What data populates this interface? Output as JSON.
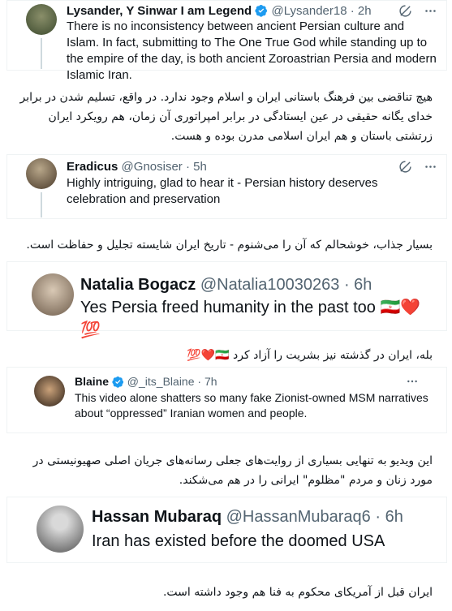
{
  "tweets": [
    {
      "name": "Lysander, Y Sinwar I am Legend",
      "handle": "@Lysander18",
      "time": "· 2h",
      "verified": true,
      "text": "There is no inconsistency between ancient Persian culture and Islam. In fact, submitting to The One True God while standing up to the empire of the day, is both ancient Zoroastrian Persia and modern Islamic Iran.",
      "translation": "هیچ تناقضی بین فرهنگ باستانی ایران و اسلام وجود ندارد. در واقع، تسلیم شدن در برابر خدای یگانه حقیقی در عین ایستادگی در برابر امپراتوری آن زمان، هم رویکرد ایران زرتشتی باستان و هم ایران اسلامی مدرن بوده و هست."
    },
    {
      "name": "Eradicus",
      "handle": "@Gnosiser",
      "time": "· 5h",
      "verified": false,
      "text": "Highly intriguing, glad to hear it - Persian history deserves celebration and preservation",
      "translation": "بسیار جذاب، خوشحالم که آن را می‌شنوم - تاریخ ایران شایسته تجلیل و حفاظت است."
    },
    {
      "name": "Natalia Bogacz",
      "handle": "@Natalia10030263",
      "time": "· 6h",
      "verified": false,
      "text": "Yes Persia freed humanity in the past too 🇮🇷❤️💯",
      "translation": "بله، ایران در گذشته نیز بشریت را آزاد کرد 🇮🇷❤️💯"
    },
    {
      "name": "Blaine",
      "handle": "@_its_Blaine",
      "time": "· 7h",
      "verified": true,
      "text": "This video alone shatters so many fake Zionist-owned MSM narratives about “oppressed” Iranian women and people.",
      "translation": "این ویدیو به تنهایی بسیاری از روایت‌های جعلی رسانه‌های جریان اصلی صهیونیستی در مورد زنان و مردم \"مظلوم\" ایرانی را در هم می‌شکند."
    },
    {
      "name": "Hassan Mubaraq",
      "handle": "@HassanMubaraq6",
      "time": "· 6h",
      "verified": false,
      "text": "Iran has existed before the doomed USA",
      "translation": "ایران قبل از آمریکای محکوم به فنا هم وجود داشته است."
    }
  ],
  "colors": {
    "verified": "#1d9bf0",
    "gray": "#536471",
    "text": "#0f1419"
  },
  "icons": [
    "grok-icon",
    "more-icon",
    "verified-badge-icon"
  ]
}
